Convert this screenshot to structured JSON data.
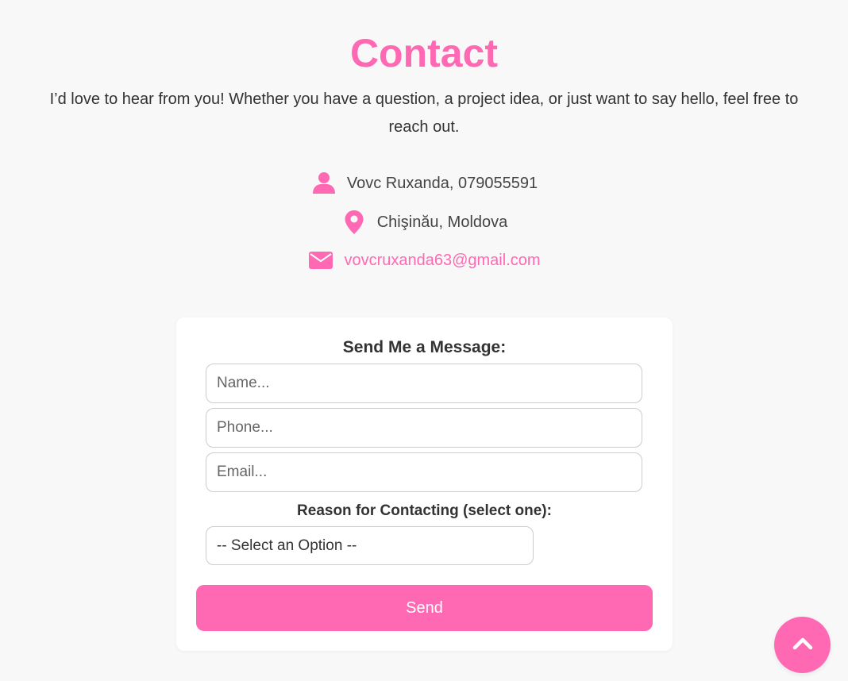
{
  "header": {
    "title": "Contact",
    "intro": "I’d love to hear from you! Whether you have a question, a project idea, or just want to say hello, feel free to reach out."
  },
  "contact_info": {
    "person": "Vovc Ruxanda, 079055591",
    "location": "Chişinău, Moldova",
    "email": "vovcruxanda63@gmail.com",
    "icons": [
      "user-icon",
      "location-pin-icon",
      "envelope-icon"
    ]
  },
  "form": {
    "title": "Send Me a Message:",
    "name_placeholder": "Name...",
    "phone_placeholder": "Phone...",
    "email_placeholder": "Email...",
    "reason_label": "Reason for Contacting (select one):",
    "reason_selected": "-- Select an Option --",
    "send_label": "Send"
  },
  "scroll_top": {
    "icon": "chevron-up-icon"
  },
  "colors": {
    "accent": "#ff69b4",
    "background": "#f8f8f8",
    "text": "#333333"
  }
}
